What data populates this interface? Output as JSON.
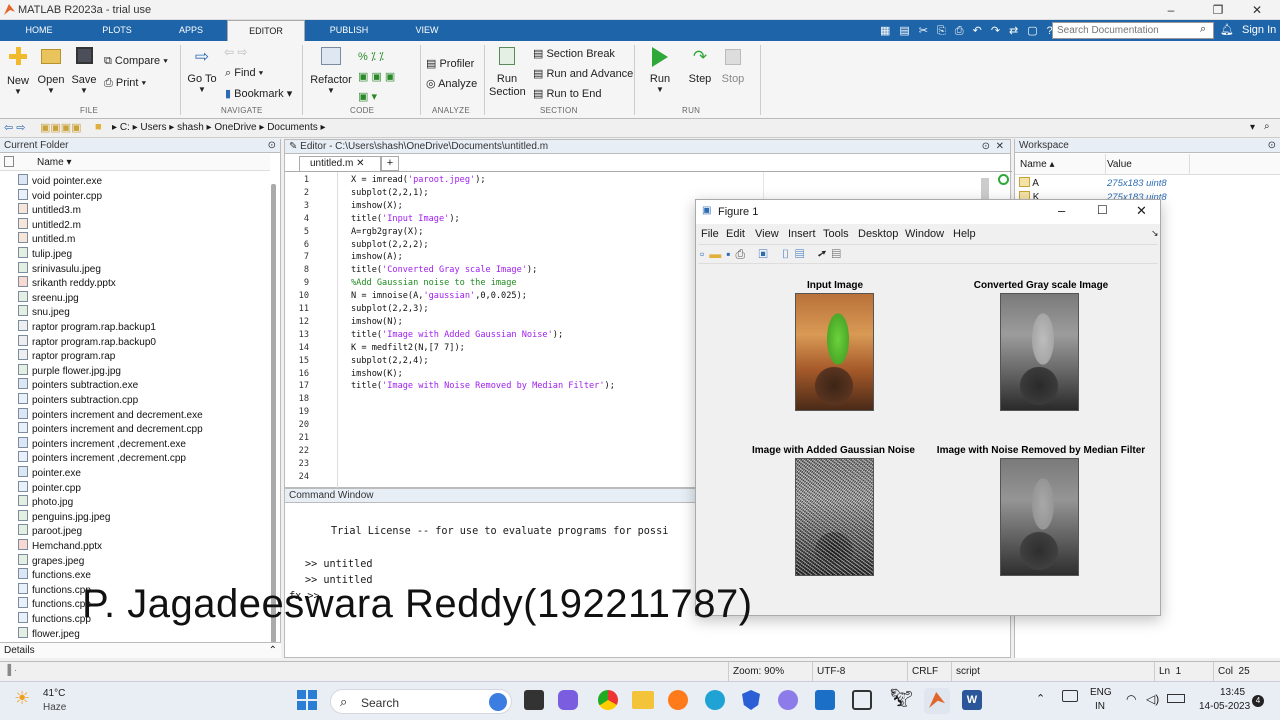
{
  "window": {
    "title": "MATLAB R2023a - trial use"
  },
  "tabs": [
    "HOME",
    "PLOTS",
    "APPS",
    "EDITOR",
    "PUBLISH",
    "VIEW"
  ],
  "active_tab": "EDITOR",
  "search": {
    "placeholder": "Search Documentation"
  },
  "sign_in": "Sign In",
  "ribbon": {
    "file": {
      "group": "FILE",
      "new": "New",
      "open": "Open",
      "save": "Save",
      "compare": "Compare",
      "print": "Print"
    },
    "navigate": {
      "group": "NAVIGATE",
      "goto": "Go To",
      "find": "Find",
      "bookmark": "Bookmark"
    },
    "code": {
      "group": "CODE",
      "refactor": "Refactor"
    },
    "analyze": {
      "group": "ANALYZE",
      "profiler": "Profiler",
      "analyze": "Analyze"
    },
    "section": {
      "group": "SECTION",
      "run_section": "Run Section",
      "section_break": "Section Break",
      "run_advance": "Run and Advance",
      "run_end": "Run to End"
    },
    "run": {
      "group": "RUN",
      "run": "Run",
      "step": "Step",
      "stop": "Stop"
    }
  },
  "address": [
    "C:",
    "Users",
    "shash",
    "OneDrive",
    "Documents"
  ],
  "current_folder": {
    "title": "Current Folder",
    "col_name": "Name",
    "files": [
      "void pointer.exe",
      "void pointer.cpp",
      "untitled3.m",
      "untitled2.m",
      "untitled.m",
      "tulip.jpeg",
      "srinivasulu.jpeg",
      "srikanth reddy.pptx",
      "sreenu.jpg",
      "snu.jpeg",
      "raptor program.rap.backup1",
      "raptor program.rap.backup0",
      "raptor program.rap",
      "purple flower.jpg.jpg",
      "pointers subtraction.exe",
      "pointers subtraction.cpp",
      "pointers increment and decrement.exe",
      "pointers increment and decrement.cpp",
      "pointers increment ,decrement.exe",
      "pointers increment ,decrement.cpp",
      "pointer.exe",
      "pointer.cpp",
      "photo.jpg",
      "penguins.jpg.jpeg",
      "paroot.jpeg",
      "Hemchand.pptx",
      "grapes.jpeg",
      "functions.exe",
      "functions.cpp",
      "functions.cpp",
      "functions.cpp",
      "flower.jpeg"
    ],
    "details": "Details"
  },
  "editor": {
    "title": "Editor - C:\\Users\\shash\\OneDrive\\Documents\\untitled.m",
    "tab": "untitled.m",
    "lines": [
      "X = imread('paroot.jpeg');",
      "subplot(2,2,1);",
      "imshow(X);",
      "title('Input Image');",
      "A=rgb2gray(X);",
      "subplot(2,2,2);",
      "imshow(A);",
      "title('Converted Gray scale Image');",
      "%Add Gaussian noise to the image",
      "N = imnoise(A,'gaussian',0,0.025);",
      "subplot(2,2,3);",
      "imshow(N);",
      "title('Image with Added Gaussian Noise');",
      "K = medfilt2(N,[7 7]);",
      "subplot(2,2,4);",
      "imshow(K);",
      "title('Image with Noise Removed by Median Filter');",
      "",
      "",
      "",
      "",
      "",
      "",
      ""
    ]
  },
  "command_window": {
    "title": "Command Window",
    "license": "Trial License -- for use to evaluate programs for possi",
    "history": [
      ">> untitled",
      ">> untitled"
    ],
    "prompt": "fx >>"
  },
  "workspace": {
    "title": "Workspace",
    "col_name": "Name",
    "col_value": "Value",
    "vars": [
      {
        "name": "A",
        "value": "275x183 uint8"
      },
      {
        "name": "K",
        "value": "275x183 uint8"
      }
    ]
  },
  "figure": {
    "title": "Figure 1",
    "menu": [
      "File",
      "Edit",
      "View",
      "Insert",
      "Tools",
      "Desktop",
      "Window",
      "Help"
    ],
    "subplots": [
      "Input Image",
      "Converted Gray scale Image",
      "Image with Added Gaussian Noise",
      "Image with Noise Removed by Median Filter"
    ]
  },
  "statusbar": {
    "zoom": "Zoom: 90%",
    "encoding": "UTF-8",
    "eol": "CRLF",
    "type": "script",
    "ln": "Ln  1",
    "col": "Col  25"
  },
  "watermark": "P. Jagadeeswara Reddy(192211787)",
  "taskbar": {
    "weather_temp": "41°C",
    "weather_desc": "Haze",
    "search": "Search",
    "lang": "ENG",
    "region": "IN",
    "time": "13:45",
    "date": "14-05-2023",
    "badge": "4"
  }
}
